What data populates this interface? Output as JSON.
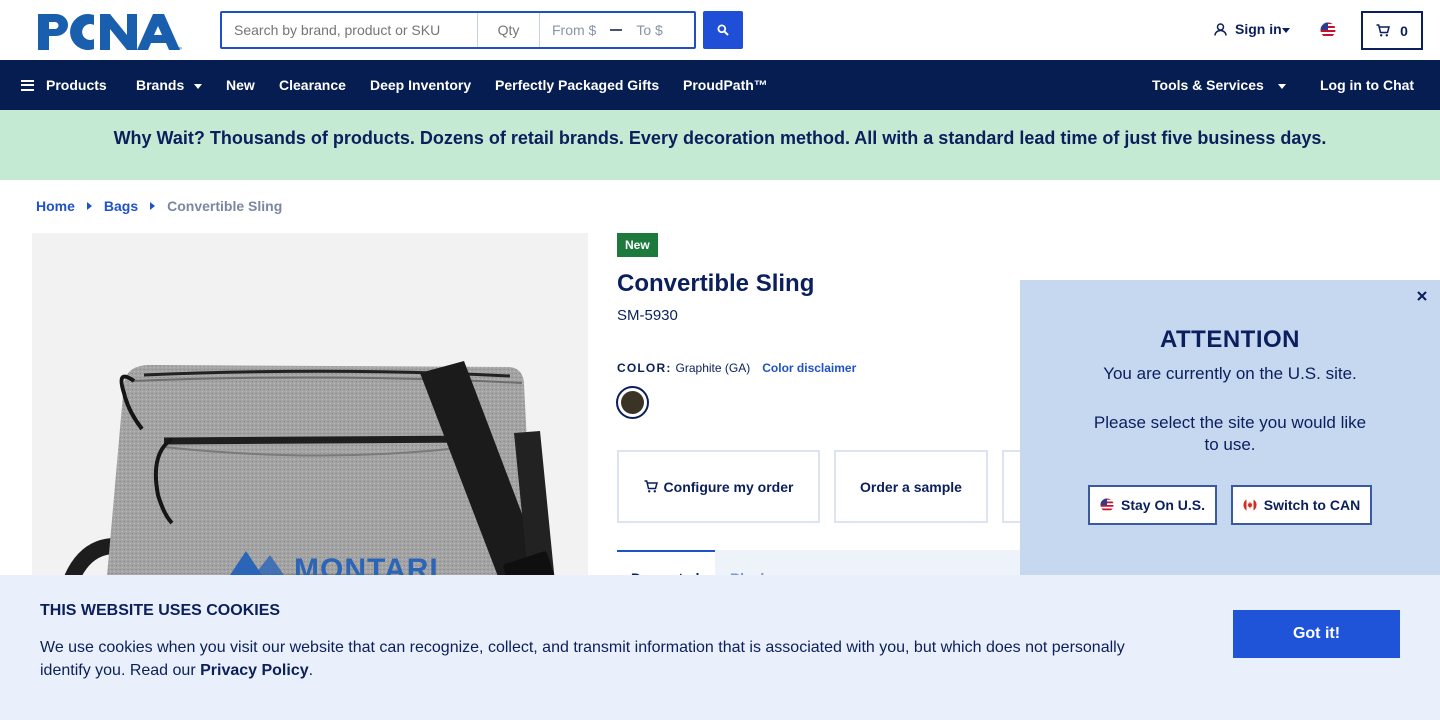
{
  "header": {
    "logo_text": "PCNA",
    "search": {
      "keyword_placeholder": "Search by brand, product or SKU",
      "qty_placeholder": "Qty",
      "from_placeholder": "From $",
      "to_placeholder": "To $"
    },
    "signin_label": "Sign in",
    "cart_count": "0"
  },
  "nav": {
    "left_items": [
      "Products",
      "Brands",
      "New",
      "Clearance",
      "Deep Inventory",
      "Perfectly Packaged Gifts",
      "ProudPath™"
    ],
    "tools_label": "Tools & Services",
    "chat_label": "Log in to Chat"
  },
  "promo": {
    "text": "Why Wait? Thousands of products. Dozens of retail brands. Every decoration method. All with a standard lead time of just five business days."
  },
  "breadcrumb": [
    "Home",
    "Bags",
    "Convertible Sling"
  ],
  "product": {
    "badge": "New",
    "title": "Convertible Sling",
    "sku": "SM-5930",
    "color_label": "COLOR:",
    "color_value": "Graphite (GA)",
    "color_disclaimer": "Color disclaimer",
    "swatch_color": "#3a3426",
    "image_brand_text": "MONTARI",
    "actions": [
      "Configure my order",
      "Order a sample"
    ],
    "tabs": [
      "Decorated",
      "Blank"
    ]
  },
  "modal": {
    "title": "ATTENTION",
    "line1": "You are currently on the U.S. site.",
    "line2": "Please select the site you would like to use.",
    "stay_label": "Stay On U.S.",
    "switch_label": "Switch to CAN"
  },
  "cookie": {
    "title": "THIS WEBSITE USES COOKIES",
    "body": "We use cookies when you visit our website that can recognize, collect, and transmit information that is associated with you, but which does not personally identify you. Read our ",
    "policy_link": "Privacy Policy",
    "body_end": ".",
    "button": "Got it!"
  },
  "colors": {
    "navy": "#0a1f5c",
    "nav_bg": "#061d52",
    "accent_blue": "#1f52c9",
    "promo_bg": "#c4ead4",
    "new_badge": "#1e7a3c"
  }
}
